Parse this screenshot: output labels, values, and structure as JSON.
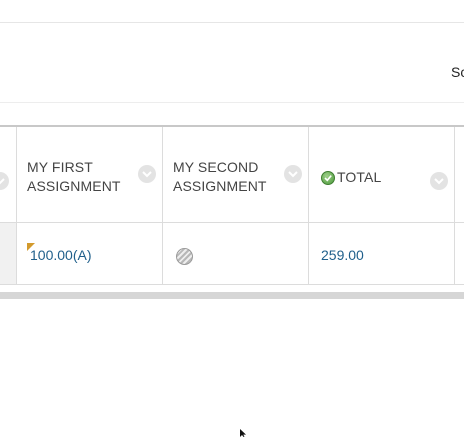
{
  "toolbar": {
    "cut_label": "Sc"
  },
  "grid": {
    "columns": [
      {
        "label": "My First Assignment"
      },
      {
        "label": "My Second Assignment"
      },
      {
        "label": "Total",
        "icon": "check-circle-icon"
      }
    ],
    "row": {
      "first_assignment": "100.00(A)",
      "second_assignment_icon": "hatched-circle-icon",
      "total": "259.00"
    }
  },
  "colors": {
    "link": "#1f5f8b",
    "flag": "#d39a2c",
    "check": "#4c9a3b"
  }
}
